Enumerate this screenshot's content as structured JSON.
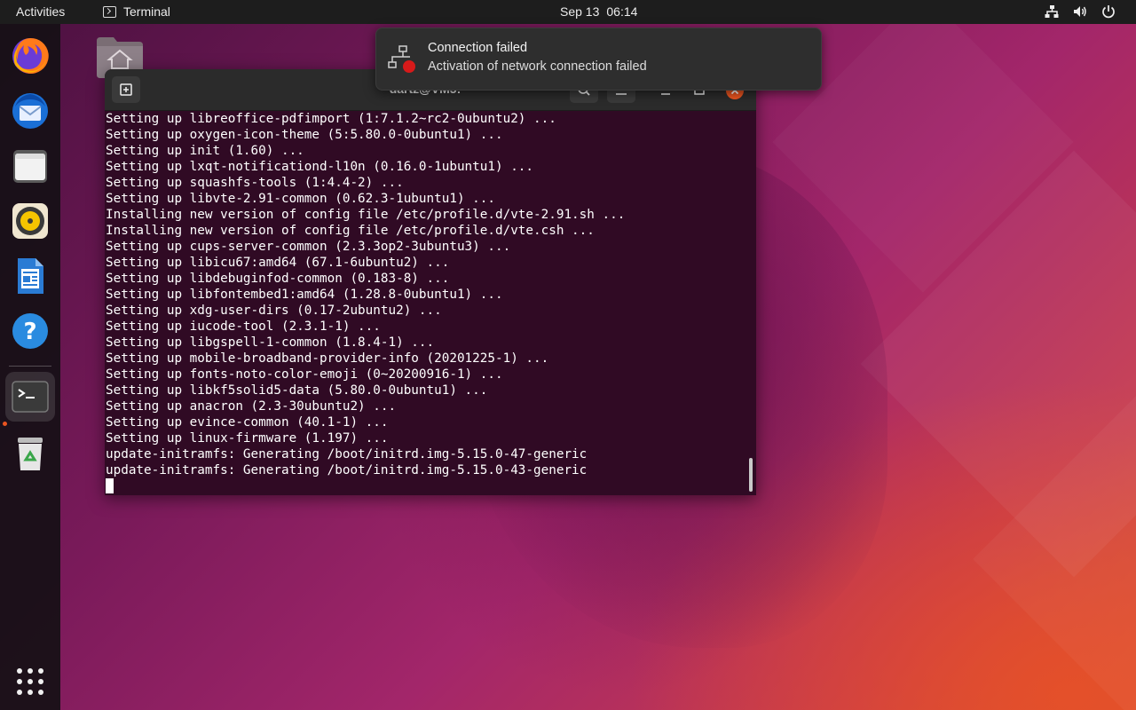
{
  "topbar": {
    "activities_label": "Activities",
    "app_menu_label": "Terminal",
    "date": "Sep 13",
    "time": "06:14"
  },
  "dock": {
    "items": [
      "Firefox",
      "Thunderbird Mail",
      "Files",
      "Rhythmbox",
      "LibreOffice Writer",
      "Help",
      "Terminal",
      "Trash"
    ],
    "active_item": "Terminal"
  },
  "terminal": {
    "title": "dartz@VM5: ~",
    "lines": [
      "Setting up libreoffice-pdfimport (1:7.1.2~rc2-0ubuntu2) ...",
      "Setting up oxygen-icon-theme (5:5.80.0-0ubuntu1) ...",
      "Setting up init (1.60) ...",
      "Setting up lxqt-notificationd-l10n (0.16.0-1ubuntu1) ...",
      "Setting up squashfs-tools (1:4.4-2) ...",
      "Setting up libvte-2.91-common (0.62.3-1ubuntu1) ...",
      "Installing new version of config file /etc/profile.d/vte-2.91.sh ...",
      "Installing new version of config file /etc/profile.d/vte.csh ...",
      "Setting up cups-server-common (2.3.3op2-3ubuntu3) ...",
      "Setting up libicu67:amd64 (67.1-6ubuntu2) ...",
      "Setting up libdebuginfod-common (0.183-8) ...",
      "Setting up libfontembed1:amd64 (1.28.8-0ubuntu1) ...",
      "Setting up xdg-user-dirs (0.17-2ubuntu2) ...",
      "Setting up iucode-tool (2.3.1-1) ...",
      "Setting up libgspell-1-common (1.8.4-1) ...",
      "Setting up mobile-broadband-provider-info (20201225-1) ...",
      "Setting up fonts-noto-color-emoji (0~20200916-1) ...",
      "Setting up libkf5solid5-data (5.80.0-0ubuntu1) ...",
      "Setting up anacron (2.3-30ubuntu2) ...",
      "Setting up evince-common (40.1-1) ...",
      "Setting up linux-firmware (1.197) ...",
      "update-initramfs: Generating /boot/initrd.img-5.15.0-47-generic",
      "update-initramfs: Generating /boot/initrd.img-5.15.0-43-generic"
    ]
  },
  "notification": {
    "title": "Connection failed",
    "body": "Activation of network connection failed"
  },
  "colors": {
    "terminal_bg": "#300a24",
    "accent": "#e95420",
    "topbar_bg": "#1d1d1d"
  }
}
